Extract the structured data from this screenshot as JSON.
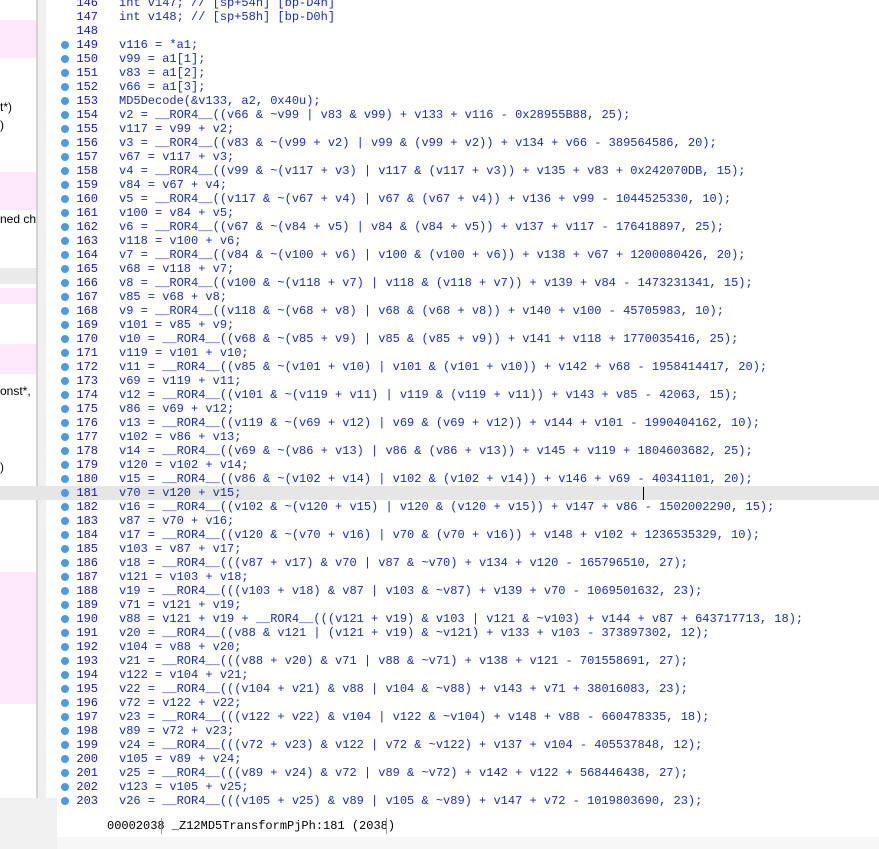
{
  "left_panel": {
    "fragments": [
      "t*)",
      ")",
      "ned ch",
      "onst*,",
      ")"
    ]
  },
  "code": {
    "lines": [
      {
        "num": "146",
        "text": "int v147; // [sp+54h] [bp-D4h]",
        "dot": false
      },
      {
        "num": "147",
        "text": "int v148; // [sp+58h] [bp-D0h]",
        "dot": false
      },
      {
        "num": "148",
        "text": "",
        "dot": false
      },
      {
        "num": "149",
        "text": "v116 = *a1;",
        "dot": true
      },
      {
        "num": "150",
        "text": "v99 = a1[1];",
        "dot": true
      },
      {
        "num": "151",
        "text": "v83 = a1[2];",
        "dot": true
      },
      {
        "num": "152",
        "text": "v66 = a1[3];",
        "dot": true
      },
      {
        "num": "153",
        "text": "MD5Decode(&v133, a2, 0x40u);",
        "dot": true
      },
      {
        "num": "154",
        "text": "v2 = __ROR4__((v66 & ~v99 | v83 & v99) + v133 + v116 - 0x28955B88, 25);",
        "dot": true
      },
      {
        "num": "155",
        "text": "v117 = v99 + v2;",
        "dot": true
      },
      {
        "num": "156",
        "text": "v3 = __ROR4__((v83 & ~(v99 + v2) | v99 & (v99 + v2)) + v134 + v66 - 389564586, 20);",
        "dot": true
      },
      {
        "num": "157",
        "text": "v67 = v117 + v3;",
        "dot": true
      },
      {
        "num": "158",
        "text": "v4 = __ROR4__((v99 & ~(v117 + v3) | v117 & (v117 + v3)) + v135 + v83 + 0x242070DB, 15);",
        "dot": true
      },
      {
        "num": "159",
        "text": "v84 = v67 + v4;",
        "dot": true
      },
      {
        "num": "160",
        "text": "v5 = __ROR4__((v117 & ~(v67 + v4) | v67 & (v67 + v4)) + v136 + v99 - 1044525330, 10);",
        "dot": true
      },
      {
        "num": "161",
        "text": "v100 = v84 + v5;",
        "dot": true
      },
      {
        "num": "162",
        "text": "v6 = __ROR4__((v67 & ~(v84 + v5) | v84 & (v84 + v5)) + v137 + v117 - 176418897, 25);",
        "dot": true
      },
      {
        "num": "163",
        "text": "v118 = v100 + v6;",
        "dot": true
      },
      {
        "num": "164",
        "text": "v7 = __ROR4__((v84 & ~(v100 + v6) | v100 & (v100 + v6)) + v138 + v67 + 1200080426, 20);",
        "dot": true
      },
      {
        "num": "165",
        "text": "v68 = v118 + v7;",
        "dot": true
      },
      {
        "num": "166",
        "text": "v8 = __ROR4__((v100 & ~(v118 + v7) | v118 & (v118 + v7)) + v139 + v84 - 1473231341, 15);",
        "dot": true
      },
      {
        "num": "167",
        "text": "v85 = v68 + v8;",
        "dot": true
      },
      {
        "num": "168",
        "text": "v9 = __ROR4__((v118 & ~(v68 + v8) | v68 & (v68 + v8)) + v140 + v100 - 45705983, 10);",
        "dot": true
      },
      {
        "num": "169",
        "text": "v101 = v85 + v9;",
        "dot": true
      },
      {
        "num": "170",
        "text": "v10 = __ROR4__((v68 & ~(v85 + v9) | v85 & (v85 + v9)) + v141 + v118 + 1770035416, 25);",
        "dot": true
      },
      {
        "num": "171",
        "text": "v119 = v101 + v10;",
        "dot": true
      },
      {
        "num": "172",
        "text": "v11 = __ROR4__((v85 & ~(v101 + v10) | v101 & (v101 + v10)) + v142 + v68 - 1958414417, 20);",
        "dot": true
      },
      {
        "num": "173",
        "text": "v69 = v119 + v11;",
        "dot": true
      },
      {
        "num": "174",
        "text": "v12 = __ROR4__((v101 & ~(v119 + v11) | v119 & (v119 + v11)) + v143 + v85 - 42063, 15);",
        "dot": true
      },
      {
        "num": "175",
        "text": "v86 = v69 + v12;",
        "dot": true
      },
      {
        "num": "176",
        "text": "v13 = __ROR4__((v119 & ~(v69 + v12) | v69 & (v69 + v12)) + v144 + v101 - 1990404162, 10);",
        "dot": true
      },
      {
        "num": "177",
        "text": "v102 = v86 + v13;",
        "dot": true
      },
      {
        "num": "178",
        "text": "v14 = __ROR4__((v69 & ~(v86 + v13) | v86 & (v86 + v13)) + v145 + v119 + 1804603682, 25);",
        "dot": true
      },
      {
        "num": "179",
        "text": "v120 = v102 + v14;",
        "dot": true
      },
      {
        "num": "180",
        "text": "v15 = __ROR4__((v86 & ~(v102 + v14) | v102 & (v102 + v14)) + v146 + v69 - 40341101, 20);",
        "dot": true
      },
      {
        "num": "181",
        "text": "v70 = v120 + v15;",
        "dot": true,
        "current": true
      },
      {
        "num": "182",
        "text": "v16 = __ROR4__((v102 & ~(v120 + v15) | v120 & (v120 + v15)) + v147 + v86 - 1502002290, 15);",
        "dot": true
      },
      {
        "num": "183",
        "text": "v87 = v70 + v16;",
        "dot": true
      },
      {
        "num": "184",
        "text": "v17 = __ROR4__((v120 & ~(v70 + v16) | v70 & (v70 + v16)) + v148 + v102 + 1236535329, 10);",
        "dot": true
      },
      {
        "num": "185",
        "text": "v103 = v87 + v17;",
        "dot": true
      },
      {
        "num": "186",
        "text": "v18 = __ROR4__(((v87 + v17) & v70 | v87 & ~v70) + v134 + v120 - 165796510, 27);",
        "dot": true
      },
      {
        "num": "187",
        "text": "v121 = v103 + v18;",
        "dot": true
      },
      {
        "num": "188",
        "text": "v19 = __ROR4__(((v103 + v18) & v87 | v103 & ~v87) + v139 + v70 - 1069501632, 23);",
        "dot": true
      },
      {
        "num": "189",
        "text": "v71 = v121 + v19;",
        "dot": true
      },
      {
        "num": "190",
        "text": "v88 = v121 + v19 + __ROR4__(((v121 + v19) & v103 | v121 & ~v103) + v144 + v87 + 643717713, 18);",
        "dot": true
      },
      {
        "num": "191",
        "text": "v20 = __ROR4__((v88 & v121 | (v121 + v19) & ~v121) + v133 + v103 - 373897302, 12);",
        "dot": true
      },
      {
        "num": "192",
        "text": "v104 = v88 + v20;",
        "dot": true
      },
      {
        "num": "193",
        "text": "v21 = __ROR4__(((v88 + v20) & v71 | v88 & ~v71) + v138 + v121 - 701558691, 27);",
        "dot": true
      },
      {
        "num": "194",
        "text": "v122 = v104 + v21;",
        "dot": true
      },
      {
        "num": "195",
        "text": "v22 = __ROR4__(((v104 + v21) & v88 | v104 & ~v88) + v143 + v71 + 38016083, 23);",
        "dot": true
      },
      {
        "num": "196",
        "text": "v72 = v122 + v22;",
        "dot": true
      },
      {
        "num": "197",
        "text": "v23 = __ROR4__(((v122 + v22) & v104 | v122 & ~v104) + v148 + v88 - 660478335, 18);",
        "dot": true
      },
      {
        "num": "198",
        "text": "v89 = v72 + v23;",
        "dot": true
      },
      {
        "num": "199",
        "text": "v24 = __ROR4__(((v72 + v23) & v122 | v72 & ~v122) + v137 + v104 - 405537848, 12);",
        "dot": true
      },
      {
        "num": "200",
        "text": "v105 = v89 + v24;",
        "dot": true
      },
      {
        "num": "201",
        "text": "v25 = __ROR4__(((v89 + v24) & v72 | v89 & ~v72) + v142 + v122 + 568446438, 27);",
        "dot": true
      },
      {
        "num": "202",
        "text": "v123 = v105 + v25;",
        "dot": true
      },
      {
        "num": "203",
        "text": "v26 = __ROR4__(((v105 + v25) & v89 | v105 & ~v89) + v147 + v72 - 1019803690, 23);",
        "dot": true
      }
    ]
  },
  "status_bar": {
    "text": "00002038 _Z12MD5TransformPjPh:181 (2038)"
  },
  "colors": {
    "code_text": "#1c2fa8",
    "line_number": "#1a1ab0",
    "breakpoint_dot": "#4d9be0",
    "current_line": "#e6e6e6",
    "left_highlight": "#fde8fb"
  }
}
